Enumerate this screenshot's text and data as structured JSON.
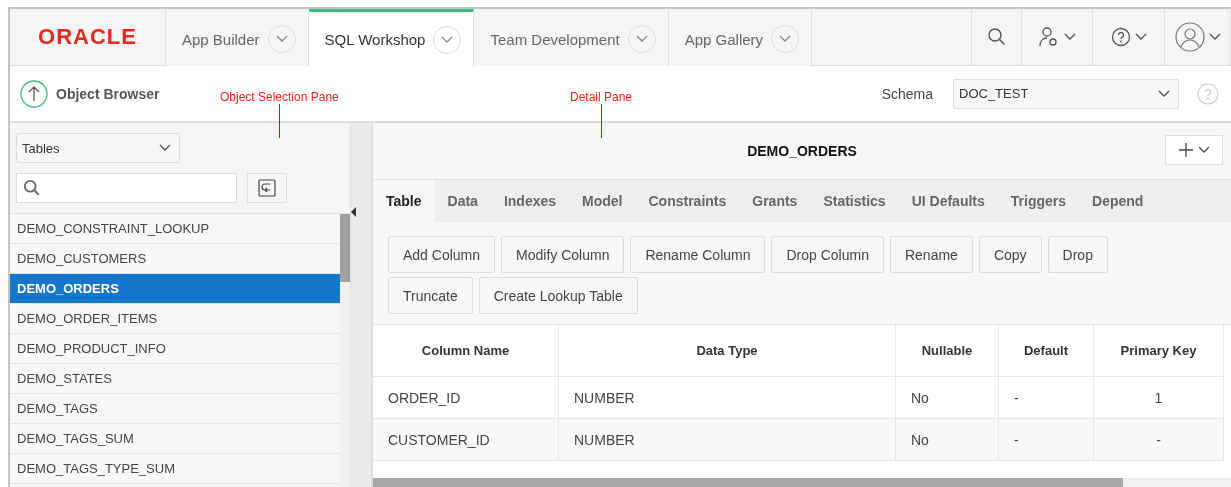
{
  "logo": "ORACLE",
  "nav_tabs": [
    {
      "label": "App Builder",
      "selected": false
    },
    {
      "label": "SQL Workshop",
      "selected": true
    },
    {
      "label": "Team Development",
      "selected": false
    },
    {
      "label": "App Gallery",
      "selected": false
    }
  ],
  "page_title": "Object Browser",
  "schema": {
    "label": "Schema",
    "value": "DOC_TEST"
  },
  "annotations": [
    "Object Selection Pane",
    "Detail Pane"
  ],
  "object_type": "Tables",
  "object_list": [
    {
      "label": "DEMO_CONSTRAINT_LOOKUP",
      "selected": false
    },
    {
      "label": "DEMO_CUSTOMERS",
      "selected": false
    },
    {
      "label": "DEMO_ORDERS",
      "selected": true
    },
    {
      "label": "DEMO_ORDER_ITEMS",
      "selected": false
    },
    {
      "label": "DEMO_PRODUCT_INFO",
      "selected": false
    },
    {
      "label": "DEMO_STATES",
      "selected": false
    },
    {
      "label": "DEMO_TAGS",
      "selected": false
    },
    {
      "label": "DEMO_TAGS_SUM",
      "selected": false
    },
    {
      "label": "DEMO_TAGS_TYPE_SUM",
      "selected": false
    }
  ],
  "detail_title": "DEMO_ORDERS",
  "detail_tabs": [
    {
      "label": "Table",
      "selected": true
    },
    {
      "label": "Data",
      "selected": false
    },
    {
      "label": "Indexes",
      "selected": false
    },
    {
      "label": "Model",
      "selected": false
    },
    {
      "label": "Constraints",
      "selected": false
    },
    {
      "label": "Grants",
      "selected": false
    },
    {
      "label": "Statistics",
      "selected": false
    },
    {
      "label": "UI Defaults",
      "selected": false
    },
    {
      "label": "Triggers",
      "selected": false
    },
    {
      "label": "Depend",
      "selected": false
    }
  ],
  "actions": [
    "Add Column",
    "Modify Column",
    "Rename Column",
    "Drop Column",
    "Rename",
    "Copy",
    "Drop",
    "Truncate",
    "Create Lookup Table"
  ],
  "table": {
    "columns": [
      "Column Name",
      "Data Type",
      "Nullable",
      "Default",
      "Primary Key"
    ],
    "rows": [
      [
        "ORDER_ID",
        "NUMBER",
        "No",
        "-",
        "1"
      ],
      [
        "CUSTOMER_ID",
        "NUMBER",
        "No",
        "-",
        "-"
      ]
    ]
  }
}
